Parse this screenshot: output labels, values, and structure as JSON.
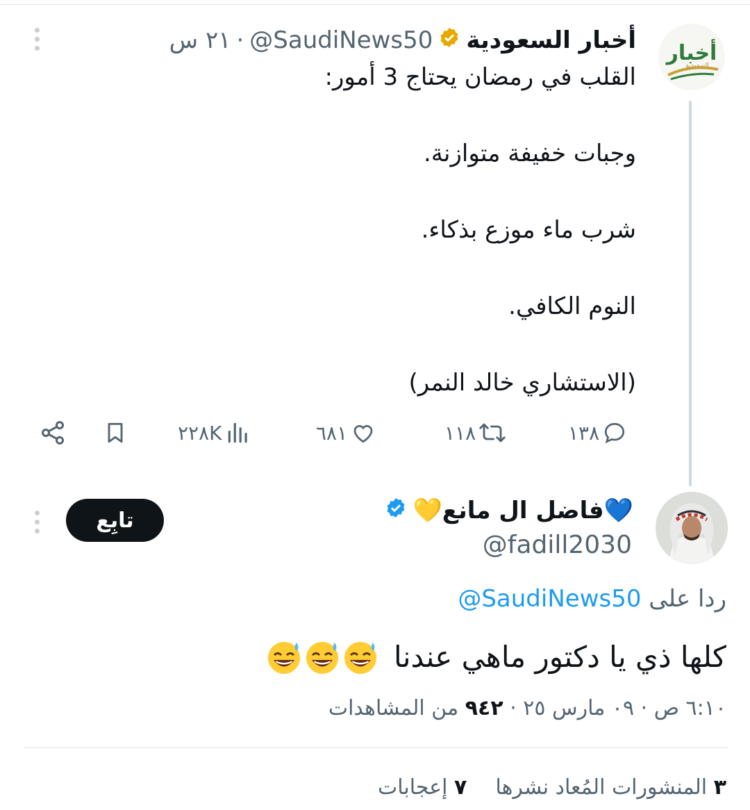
{
  "parent": {
    "author_name": "أخبار السعودية",
    "handle": "@SaudiNews50",
    "separator": "·",
    "time": "٢١ س",
    "logo_text": "أخبار",
    "logo_subtext": "السعودية",
    "body": "القلب في رمضان يحتاج 3 أمور:\n\nوجبات خفيفة متوازنة.\n\nشرب ماء موزع بذكاء.\n\nالنوم الكافي.\n\n(الاستشاري خالد النمر)",
    "actions": {
      "replies": "١٣٨",
      "reposts": "١١٨",
      "likes": "٦٨١",
      "views": "٢٢٨K"
    }
  },
  "reply": {
    "author_name": "💙فاضل ال مانع💛",
    "handle": "@fadill2030",
    "follow_label": "تابِع",
    "replying_to_prefix": "ردا على",
    "replying_to_handle": "@SaudiNews50",
    "body": "كلها ذي  يا دكتور ماهي  عندنا",
    "meta_time": "٦:١٠ ص · ٠٩ مارس ٢٥ ·",
    "meta_views_count": "٩٤٢",
    "meta_views_label": "من المشاهدات",
    "reposts_count": "٣",
    "reposts_label": "المنشورات المُعاد نشرها",
    "likes_count": "٧",
    "likes_label": "إعجابات"
  },
  "colors": {
    "accent": "#1d9bf0",
    "gold_badge": "#f4b400",
    "muted": "#536471",
    "text": "#0f1419"
  },
  "icons": [
    "verified-gold-icon",
    "verified-blue-icon",
    "reply-icon",
    "repost-icon",
    "like-icon",
    "views-icon",
    "bookmark-icon",
    "share-icon",
    "more-icon",
    "sweat-smile-emoji"
  ]
}
